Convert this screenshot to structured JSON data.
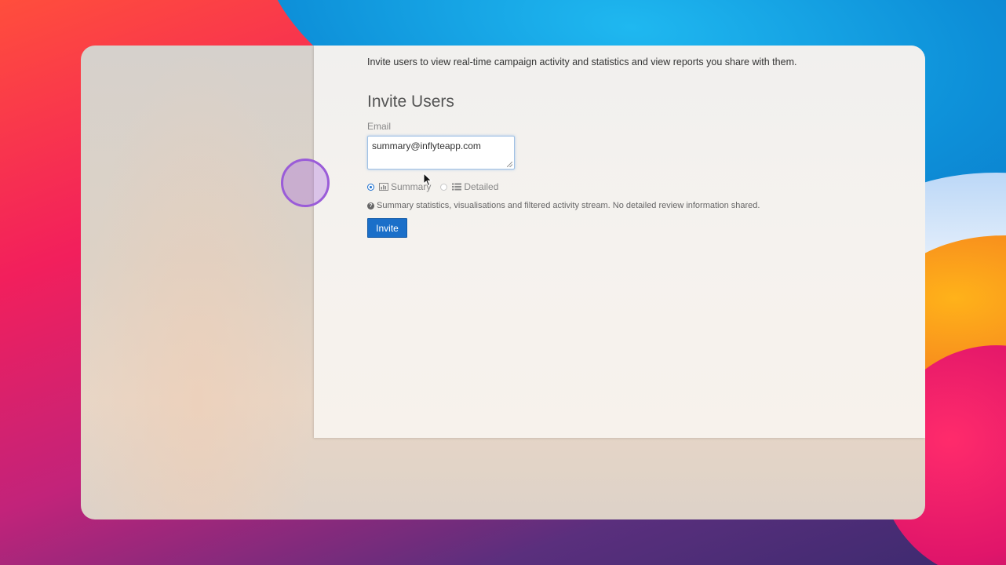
{
  "intro": {
    "text": "Invite users to view real-time campaign activity and statistics and view reports you share with them."
  },
  "invite_form": {
    "title": "Invite Users",
    "email_label": "Email",
    "email_value": "summary@inflyteapp.com",
    "options": [
      {
        "label": "Summary",
        "icon": "bar-chart-icon",
        "selected": true
      },
      {
        "label": "Detailed",
        "icon": "list-icon",
        "selected": false
      }
    ],
    "help_icon": "question-circle-icon",
    "help_text": "Summary statistics, visualisations and filtered activity stream. No detailed review information shared.",
    "submit_label": "Invite"
  },
  "colors": {
    "primary_button": "#1a6fc9",
    "radio_selected": "#1a6fd0",
    "click_indicator": "#9a5cd8",
    "input_focus": "#9fc0e4"
  }
}
